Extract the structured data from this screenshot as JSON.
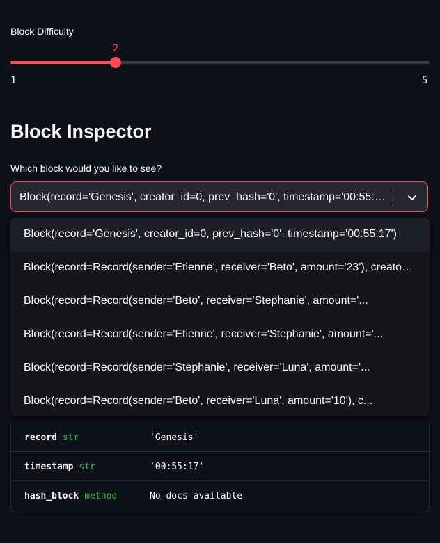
{
  "slider": {
    "label": "Block Difficulty",
    "value": "2",
    "min": "1",
    "max": "5",
    "fraction": 0.25
  },
  "inspector": {
    "title": "Block Inspector",
    "select_label": "Which block would you like to see?",
    "selected": "Block(record='Genesis', creator_id=0, prev_hash='0', timestamp='00:55:17')"
  },
  "options": [
    "Block(record='Genesis', creator_id=0, prev_hash='0', timestamp='00:55:17')",
    "Block(record=Record(sender='Etienne', receiver='Beto', amount='23'), creator_id=...",
    "Block(record=Record(sender='Beto', receiver='Stephanie', amount='...",
    "Block(record=Record(sender='Etienne', receiver='Stephanie', amount='...",
    "Block(record=Record(sender='Stephanie', receiver='Luna', amount='...",
    "Block(record=Record(sender='Beto', receiver='Luna', amount='10'), c..."
  ],
  "doc": [
    {
      "name": "record",
      "type": "str",
      "value": "'Genesis'"
    },
    {
      "name": "timestamp",
      "type": "str",
      "value": "'00:55:17'"
    },
    {
      "name": "hash_block",
      "type": "method",
      "value": "No docs available"
    }
  ],
  "colors": {
    "accent": "#ff4b4b",
    "background": "#0e1117",
    "type_green": "#21c354"
  },
  "icons": {
    "chevron": "chevron-down-icon"
  }
}
